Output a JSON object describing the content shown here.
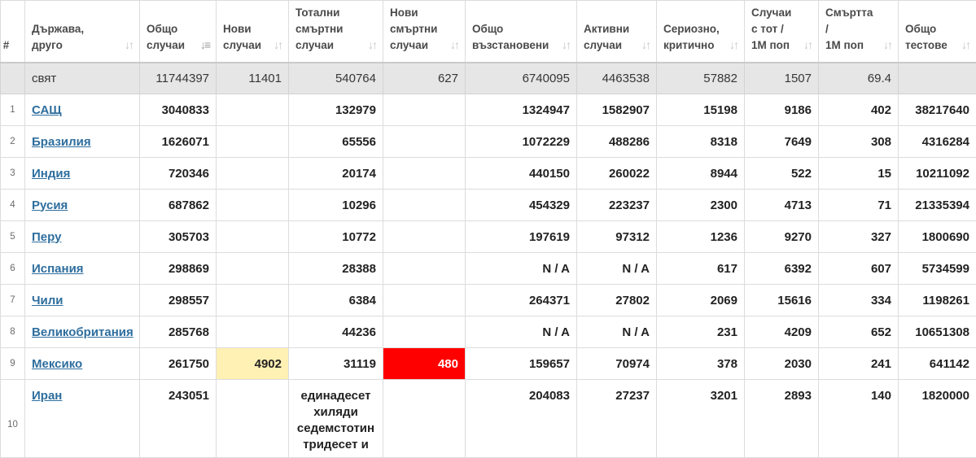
{
  "columns": [
    {
      "key": "idx",
      "label": "#",
      "sort": false
    },
    {
      "key": "country",
      "label": "Държава,\nдруго",
      "sort": true
    },
    {
      "key": "total_cases",
      "label": "Общо\nслучаи",
      "sort": true,
      "active": true
    },
    {
      "key": "new_cases",
      "label": "Нови\nслучаи",
      "sort": true
    },
    {
      "key": "total_deaths",
      "label": "Тотални\nсмъртни\nслучаи",
      "sort": true
    },
    {
      "key": "new_deaths",
      "label": "Нови\nсмъртни\nслучаи",
      "sort": true
    },
    {
      "key": "total_recovered",
      "label": "Общо\nвъзстановени",
      "sort": true
    },
    {
      "key": "active_cases",
      "label": "Активни\nслучаи",
      "sort": true
    },
    {
      "key": "serious",
      "label": "Сериозно,\nкритично",
      "sort": true
    },
    {
      "key": "cases_per_m",
      "label": "Случаи\nс тот /\n1М поп",
      "sort": true
    },
    {
      "key": "deaths_per_m",
      "label": "Смъртта\n/\n1М поп",
      "sort": true
    },
    {
      "key": "total_tests",
      "label": "Общо\nтестове",
      "sort": true
    }
  ],
  "world": {
    "country": "свят",
    "total_cases": "11744397",
    "new_cases": "11401",
    "total_deaths": "540764",
    "new_deaths": "627",
    "total_recovered": "6740095",
    "active_cases": "4463538",
    "serious": "57882",
    "cases_per_m": "1507",
    "deaths_per_m": "69.4",
    "total_tests": ""
  },
  "rows": [
    {
      "idx": "1",
      "country": "САЩ",
      "total_cases": "3040833",
      "new_cases": "",
      "total_deaths": "132979",
      "new_deaths": "",
      "total_recovered": "1324947",
      "active_cases": "1582907",
      "serious": "15198",
      "cases_per_m": "9186",
      "deaths_per_m": "402",
      "total_tests": "38217640"
    },
    {
      "idx": "2",
      "country": "Бразилия",
      "total_cases": "1626071",
      "new_cases": "",
      "total_deaths": "65556",
      "new_deaths": "",
      "total_recovered": "1072229",
      "active_cases": "488286",
      "serious": "8318",
      "cases_per_m": "7649",
      "deaths_per_m": "308",
      "total_tests": "4316284"
    },
    {
      "idx": "3",
      "country": "Индия",
      "total_cases": "720346",
      "new_cases": "",
      "total_deaths": "20174",
      "new_deaths": "",
      "total_recovered": "440150",
      "active_cases": "260022",
      "serious": "8944",
      "cases_per_m": "522",
      "deaths_per_m": "15",
      "total_tests": "10211092"
    },
    {
      "idx": "4",
      "country": "Русия",
      "total_cases": "687862",
      "new_cases": "",
      "total_deaths": "10296",
      "new_deaths": "",
      "total_recovered": "454329",
      "active_cases": "223237",
      "serious": "2300",
      "cases_per_m": "4713",
      "deaths_per_m": "71",
      "total_tests": "21335394"
    },
    {
      "idx": "5",
      "country": "Перу",
      "total_cases": "305703",
      "new_cases": "",
      "total_deaths": "10772",
      "new_deaths": "",
      "total_recovered": "197619",
      "active_cases": "97312",
      "serious": "1236",
      "cases_per_m": "9270",
      "deaths_per_m": "327",
      "total_tests": "1800690"
    },
    {
      "idx": "6",
      "country": "Испания",
      "total_cases": "298869",
      "new_cases": "",
      "total_deaths": "28388",
      "new_deaths": "",
      "total_recovered": "N / A",
      "active_cases": "N / A",
      "serious": "617",
      "cases_per_m": "6392",
      "deaths_per_m": "607",
      "total_tests": "5734599"
    },
    {
      "idx": "7",
      "country": "Чили",
      "total_cases": "298557",
      "new_cases": "",
      "total_deaths": "6384",
      "new_deaths": "",
      "total_recovered": "264371",
      "active_cases": "27802",
      "serious": "2069",
      "cases_per_m": "15616",
      "deaths_per_m": "334",
      "total_tests": "1198261"
    },
    {
      "idx": "8",
      "country": "Великобритания",
      "total_cases": "285768",
      "new_cases": "",
      "total_deaths": "44236",
      "new_deaths": "",
      "total_recovered": "N / A",
      "active_cases": "N / A",
      "serious": "231",
      "cases_per_m": "4209",
      "deaths_per_m": "652",
      "total_tests": "10651308"
    },
    {
      "idx": "9",
      "country": "Мексико",
      "total_cases": "261750",
      "new_cases": "4902",
      "total_deaths": "31119",
      "new_deaths": "480",
      "total_recovered": "159657",
      "active_cases": "70974",
      "serious": "378",
      "cases_per_m": "2030",
      "deaths_per_m": "241",
      "total_tests": "641142"
    },
    {
      "idx": "10",
      "country": "Иран",
      "total_cases": "243051",
      "new_cases": "",
      "total_deaths": "единадесет хиляди седемстотин тридесет и",
      "new_deaths": "",
      "total_recovered": "204083",
      "active_cases": "27237",
      "serious": "3201",
      "cases_per_m": "2893",
      "deaths_per_m": "140",
      "total_tests": "1820000"
    }
  ],
  "colors": {
    "highlight_new_cases": "#fff0b3",
    "highlight_new_deaths": "#ff0000",
    "link": "#2e6e9e",
    "world_row": "#e6e6e6"
  },
  "sort_icons": {
    "default": "sort-arrows-icon",
    "active": "sort-desc-icon"
  }
}
